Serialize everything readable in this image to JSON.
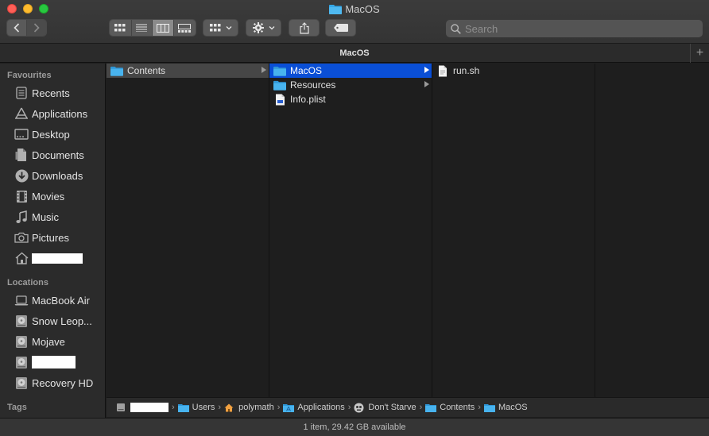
{
  "window": {
    "title": "MacOS"
  },
  "toolbar": {
    "back_label": "<",
    "forward_label": ">",
    "search_placeholder": "Search"
  },
  "path_tab": {
    "label": "MacOS",
    "add_label": "+"
  },
  "sidebar": {
    "favourites_heading": "Favourites",
    "favourites": [
      {
        "label": "Recents",
        "icon": "clock-icon"
      },
      {
        "label": "Applications",
        "icon": "applications-icon"
      },
      {
        "label": "Desktop",
        "icon": "desktop-icon"
      },
      {
        "label": "Documents",
        "icon": "document-icon"
      },
      {
        "label": "Downloads",
        "icon": "download-icon"
      },
      {
        "label": "Movies",
        "icon": "film-icon"
      },
      {
        "label": "Music",
        "icon": "music-note-icon"
      },
      {
        "label": "Pictures",
        "icon": "camera-icon"
      },
      {
        "label": "",
        "icon": "home-icon"
      }
    ],
    "locations_heading": "Locations",
    "locations": [
      {
        "label": "MacBook Air",
        "icon": "laptop-icon"
      },
      {
        "label": "Snow Leop...",
        "icon": "disk-icon"
      },
      {
        "label": "Mojave",
        "icon": "disk-icon"
      },
      {
        "label": "",
        "icon": "disk-icon"
      },
      {
        "label": "Recovery HD",
        "icon": "disk-icon"
      }
    ],
    "tags_heading": "Tags"
  },
  "columns": {
    "col1": [
      {
        "label": "Contents"
      }
    ],
    "col2": [
      {
        "label": "MacOS"
      },
      {
        "label": "Resources"
      },
      {
        "label": "Info.plist"
      }
    ],
    "col3": [
      {
        "label": "run.sh"
      }
    ]
  },
  "breadcrumb": [
    "",
    "Users",
    "polymath",
    "Applications",
    "Don't Starve",
    "Contents",
    "MacOS"
  ],
  "status": {
    "text": "1 item, 29.42 GB available"
  },
  "colors": {
    "selection_blue": "#0a4fd6",
    "folder_blue": "#35a8e8"
  }
}
